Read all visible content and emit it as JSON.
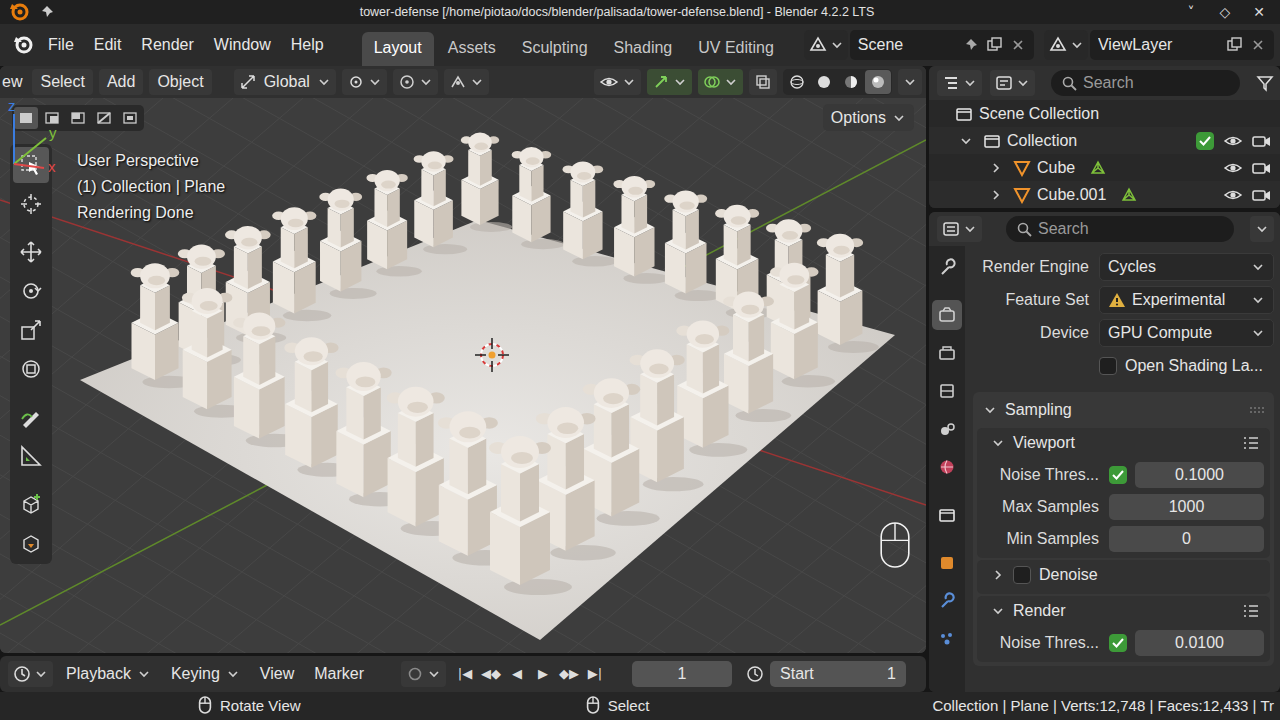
{
  "window": {
    "title": "tower-defense [/home/piotao/docs/blender/palisada/tower-defense.blend] - Blender 4.2.2 LTS",
    "controls": [
      "˅",
      "◇",
      "✕"
    ]
  },
  "menu": [
    "File",
    "Edit",
    "Render",
    "Window",
    "Help"
  ],
  "workspaces": [
    {
      "label": "Layout",
      "selected": true
    },
    {
      "label": "Assets",
      "selected": false
    },
    {
      "label": "Sculpting",
      "selected": false
    },
    {
      "label": "Shading",
      "selected": false
    },
    {
      "label": "UV Editing",
      "selected": false
    }
  ],
  "scene": {
    "name": "Scene"
  },
  "view_layer": {
    "name": "ViewLayer"
  },
  "viewport": {
    "menus": [
      "ew",
      "Select",
      "Add",
      "Object"
    ],
    "orientation": "Global",
    "toggles": [
      {
        "on": false
      },
      {
        "on": false
      },
      {
        "on": true
      },
      {
        "on": true
      },
      {
        "on": false
      }
    ],
    "shading": [
      {
        "selected": false
      },
      {
        "selected": false
      },
      {
        "selected": false
      },
      {
        "selected": true
      }
    ],
    "select_modes": [
      {
        "selected": true
      },
      {
        "selected": false
      },
      {
        "selected": false
      },
      {
        "selected": false
      },
      {
        "selected": false
      }
    ],
    "options": "Options",
    "overlay": [
      "User Perspective",
      "(1) Collection | Plane",
      "Rendering Done"
    ],
    "axes": [
      "z",
      "y",
      "x"
    ],
    "tools": [
      {
        "selected": true
      },
      {
        "selected": false
      },
      {
        "selected": false
      },
      {
        "selected": false
      },
      {
        "selected": false
      },
      {
        "selected": false
      },
      {
        "selected": false
      },
      {
        "selected": false
      },
      {
        "selected": false
      },
      {
        "selected": false
      }
    ]
  },
  "outliner": {
    "search": {
      "placeholder": "Search"
    },
    "items": [
      {
        "label": "Scene Collection",
        "kind": "scene"
      },
      {
        "label": "Collection",
        "kind": "collection",
        "expanded": true,
        "checked": true
      },
      {
        "label": "Cube",
        "kind": "mesh",
        "expanded": false
      },
      {
        "label": "Cube.001",
        "kind": "mesh",
        "expanded": false
      }
    ]
  },
  "properties": {
    "search": {
      "placeholder": "Search"
    },
    "tabs": [
      {
        "selected": false
      },
      {
        "selected": true
      },
      {
        "selected": false
      },
      {
        "selected": false
      },
      {
        "selected": false
      },
      {
        "selected": false
      },
      {
        "selected": false
      },
      {
        "selected": false
      },
      {
        "selected": false
      },
      {
        "selected": false
      }
    ],
    "rows": [
      {
        "kind": "dropdown",
        "label": "Render Engine",
        "value": "Cycles"
      },
      {
        "kind": "dropdown",
        "label": "Feature Set",
        "value": "Experimental",
        "warning": true
      },
      {
        "kind": "dropdown",
        "label": "Device",
        "value": "GPU Compute"
      },
      {
        "kind": "checkbox",
        "label": "Open Shading La...",
        "checked": false
      }
    ],
    "panels": [
      {
        "label": "Sampling",
        "expanded": true,
        "subpanels": [
          {
            "label": "Viewport",
            "expanded": true,
            "rows": [
              {
                "kind": "checknumber",
                "label": "Noise Thres...",
                "checked": true,
                "value": "0.1000"
              },
              {
                "kind": "number",
                "label": "Max Samples",
                "value": "1000"
              },
              {
                "kind": "number",
                "label": "Min Samples",
                "value": "0"
              }
            ]
          },
          {
            "label": "Denoise",
            "expanded": false,
            "checked": false,
            "rows": []
          },
          {
            "label": "Render",
            "expanded": true,
            "rows": [
              {
                "kind": "checknumber",
                "label": "Noise Thres...",
                "checked": true,
                "value": "0.0100"
              }
            ]
          }
        ]
      }
    ]
  },
  "timeline": {
    "menus": [
      {
        "label": "Playback",
        "kind": "dropdown"
      },
      {
        "label": "Keying",
        "kind": "dropdown"
      },
      {
        "label": "View",
        "kind": "menu"
      },
      {
        "label": "Marker",
        "kind": "menu"
      }
    ],
    "auto_keying": {
      "on": false
    },
    "controls": [
      "|◀",
      "◀◆",
      "◀",
      "▶",
      "◆▶",
      "▶|"
    ],
    "frame": "1",
    "start": {
      "label": "Start",
      "value": "1"
    }
  },
  "status_bar": {
    "hints": [
      "Rotate View",
      "Select"
    ],
    "stats": "Collection | Plane | Verts:12,748 | Faces:12,433 | Tr"
  }
}
